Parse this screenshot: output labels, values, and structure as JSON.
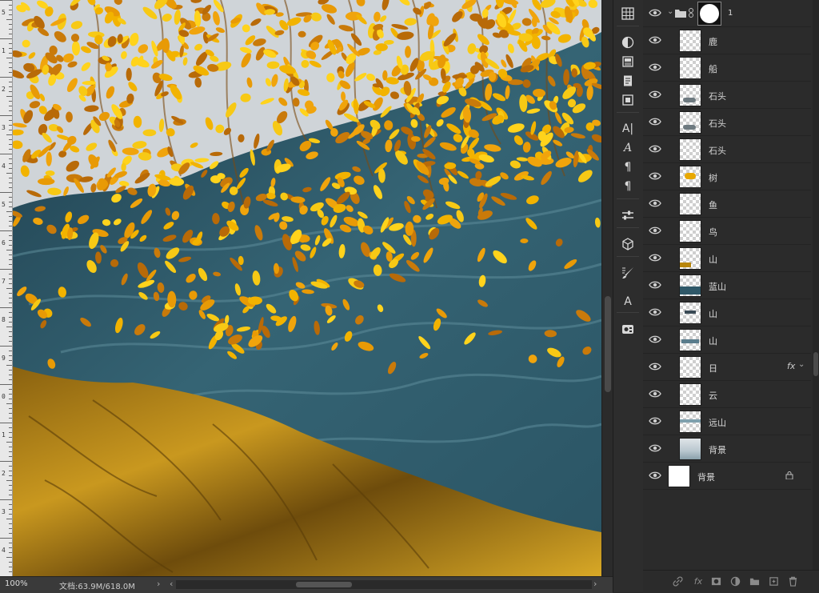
{
  "status": {
    "zoom": "100%",
    "doc_info": "文档:63.9M/618.0M",
    "arrow_right": "›",
    "arrow_left": "‹",
    "arrow_end": "›"
  },
  "ruler": {
    "labels": [
      "5",
      "1",
      "2",
      "3",
      "4",
      "5",
      "6",
      "7",
      "8",
      "9",
      "0",
      "1",
      "2",
      "3",
      "4"
    ]
  },
  "tools": [
    {
      "name": "grid-icon"
    },
    {
      "name": "adjustments-icon"
    },
    {
      "name": "panel-icon"
    },
    {
      "name": "document-icon"
    },
    {
      "name": "frame-icon"
    },
    {
      "name": "character-icon",
      "glyph": "A|"
    },
    {
      "name": "glyphs-icon",
      "glyph": "A"
    },
    {
      "name": "paragraph-styles-icon",
      "glyph": "¶"
    },
    {
      "name": "paragraph-icon",
      "glyph": "¶"
    },
    {
      "name": "properties-icon"
    },
    {
      "name": "3d-icon"
    },
    {
      "name": "brush-settings-icon"
    },
    {
      "name": "type-transform-icon",
      "glyph": "A"
    },
    {
      "name": "libraries-icon"
    }
  ],
  "layers": {
    "group": {
      "name": "1"
    },
    "items": [
      {
        "name": "鹿",
        "thumb": "empty"
      },
      {
        "name": "船",
        "thumb": "empty"
      },
      {
        "name": "石头",
        "thumb": "rock"
      },
      {
        "name": "石头",
        "thumb": "rock"
      },
      {
        "name": "石头",
        "thumb": "empty"
      },
      {
        "name": "树",
        "thumb": "tree"
      },
      {
        "name": "鱼",
        "thumb": "empty"
      },
      {
        "name": "鸟",
        "thumb": "empty"
      },
      {
        "name": "山",
        "thumb": "hill"
      },
      {
        "name": "蓝山",
        "thumb": "bluehill"
      },
      {
        "name": "山",
        "thumb": "hill2"
      },
      {
        "name": "山",
        "thumb": "hill3"
      },
      {
        "name": "日",
        "thumb": "empty",
        "fx": "fx"
      },
      {
        "name": "云",
        "thumb": "empty"
      },
      {
        "name": "远山",
        "thumb": "far"
      },
      {
        "name": "背景",
        "thumb": "bgimg"
      }
    ],
    "background": {
      "name": "背景"
    }
  },
  "colors": {
    "sky": "#cfd4d8",
    "river": "#2f5868",
    "gold": "#b88a1a",
    "leaves": "#f2b300"
  }
}
